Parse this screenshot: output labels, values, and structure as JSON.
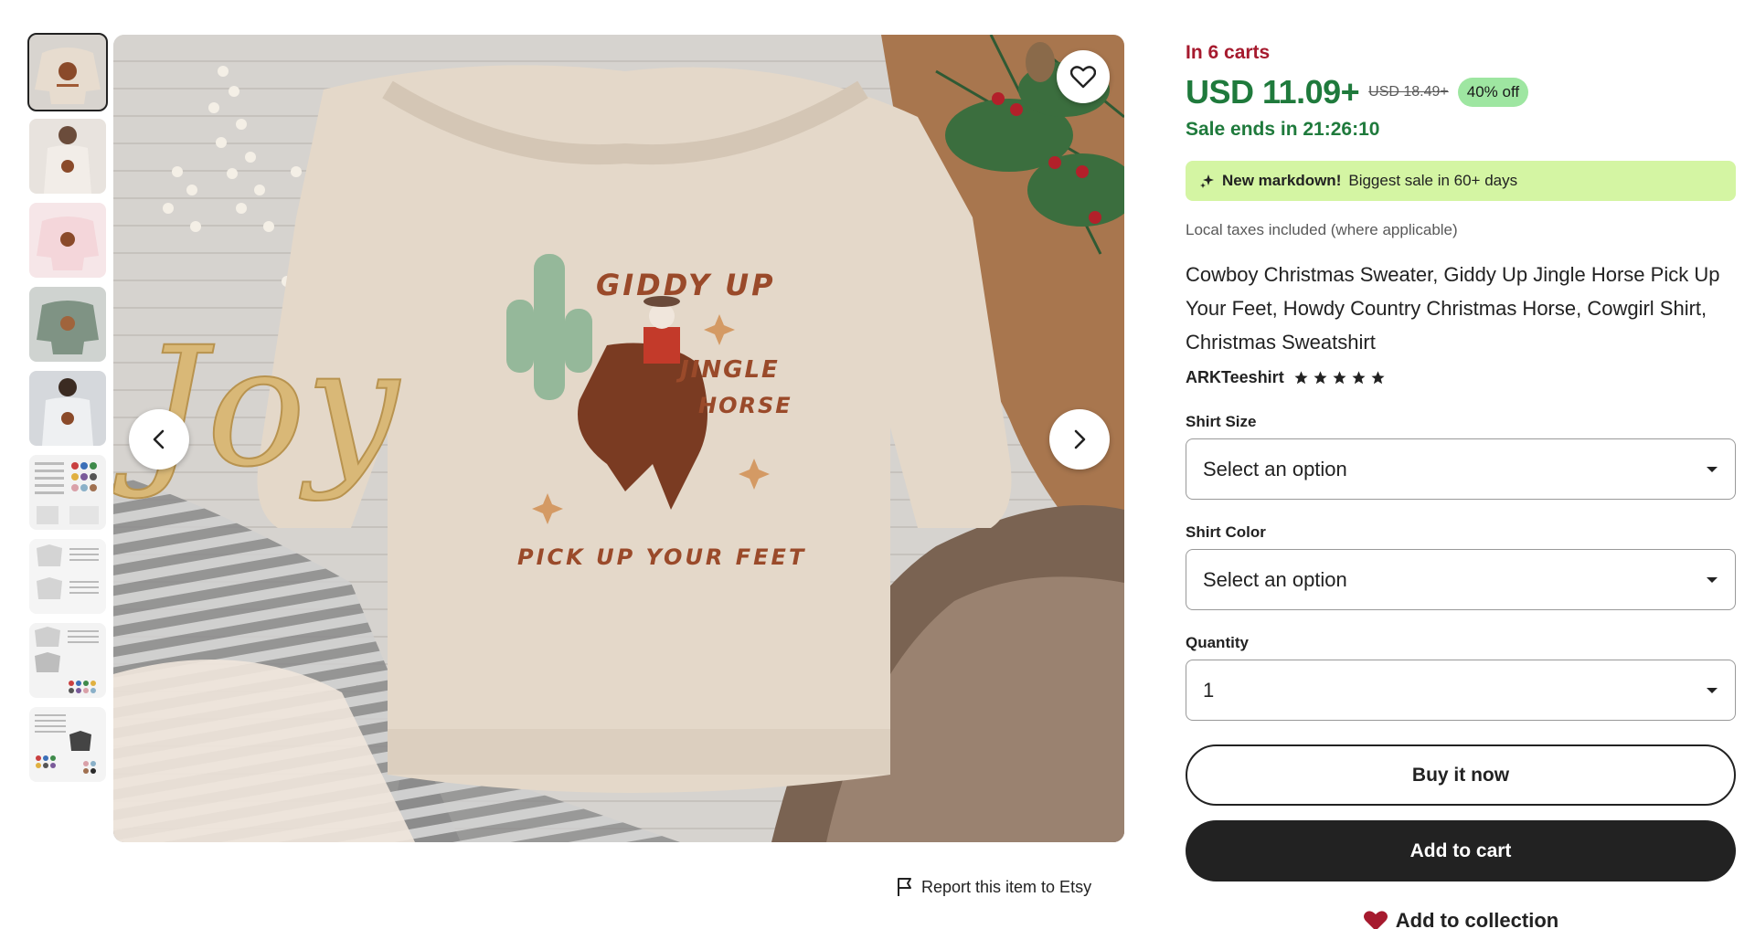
{
  "gallery": {
    "thumbnails": [
      {
        "name": "thumb-1",
        "bg": "#d8cfc6"
      },
      {
        "name": "thumb-2",
        "bg": "#e6e1dc"
      },
      {
        "name": "thumb-3",
        "bg": "#f1d9dc"
      },
      {
        "name": "thumb-4",
        "bg": "#7f9384"
      },
      {
        "name": "thumb-5",
        "bg": "#dfe1e4"
      },
      {
        "name": "thumb-6",
        "bg": "#eeeeee"
      },
      {
        "name": "thumb-7",
        "bg": "#f2f2f2"
      },
      {
        "name": "thumb-8",
        "bg": "#f0f0f0"
      },
      {
        "name": "thumb-9",
        "bg": "#f3f3f3"
      }
    ],
    "design_text": {
      "line1": "GIDDY UP",
      "line2": "JINGLE",
      "line3": "HORSE",
      "line4": "PICK UP YOUR FEET",
      "joy": "Joy"
    },
    "report_label": "Report this item to Etsy"
  },
  "listing": {
    "in_carts": "In 6 carts",
    "price": "USD 11.09+",
    "original_price": "USD 18.49+",
    "discount": "40% off",
    "sale_ends": "Sale ends in 21:26:10",
    "markdown_bold": "New markdown!",
    "markdown_rest": "Biggest sale in 60+ days",
    "taxes": "Local taxes included (where applicable)",
    "title": "Cowboy Christmas Sweater, Giddy Up Jingle Horse Pick Up Your Feet, Howdy Country Christmas Horse, Cowgirl Shirt, Christmas Sweatshirt",
    "shop_name": "ARKTeeshirt",
    "rating": 5
  },
  "options": {
    "size_label": "Shirt Size",
    "size_value": "Select an option",
    "color_label": "Shirt Color",
    "color_value": "Select an option",
    "quantity_label": "Quantity",
    "quantity_value": "1"
  },
  "actions": {
    "buy_now": "Buy it now",
    "add_to_cart": "Add to cart",
    "add_to_collection": "Add to collection"
  },
  "colors": {
    "price_green": "#1f7a3c",
    "carts_red": "#a61a2e",
    "discount_bg": "#9ee6a1",
    "markdown_bg": "#d4f5a3",
    "heart_red": "#a61a2e"
  }
}
